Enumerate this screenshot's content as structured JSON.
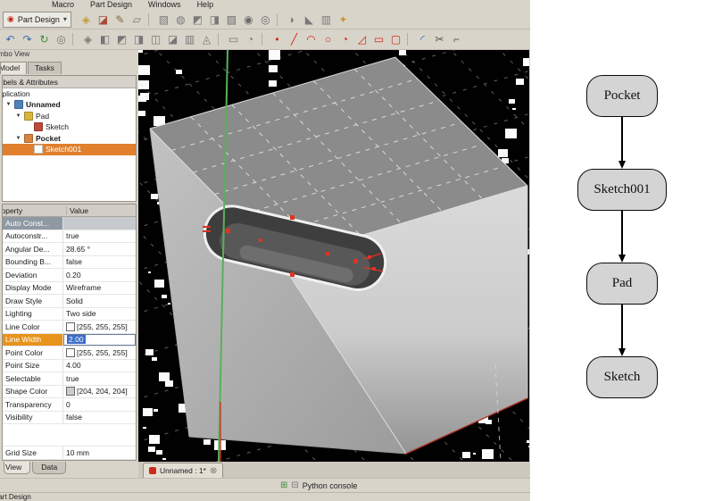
{
  "colors": {
    "selection_orange": "#e0802e",
    "edit_blue": "#3a6cc8",
    "viewport_green": "#58b158",
    "marker_red": "#e03322",
    "node_fill": "#d4d4d4",
    "line_color_value": "#ffffff",
    "shape_color_value": "#cccccc"
  },
  "menubar": {
    "items": [
      {
        "label": "Macro",
        "name": "menu-macro"
      },
      {
        "label": "Part Design",
        "name": "menu-part-design"
      },
      {
        "label": "Windows",
        "name": "menu-windows"
      },
      {
        "label": "Help",
        "name": "menu-help"
      }
    ]
  },
  "workbench_selector": {
    "label": "Part Design",
    "caret": "▾"
  },
  "toolbar_top": {
    "icons": [
      {
        "name": "create-body-icon",
        "glyph": "◈",
        "color": "#c49a3a"
      },
      {
        "name": "create-sketch-icon",
        "glyph": "◪",
        "color": "#a84a3a"
      },
      {
        "name": "edit-sketch-icon",
        "glyph": "✎",
        "color": "#7c6a3a"
      },
      {
        "name": "map-sketch-icon",
        "glyph": "▱",
        "color": "#787878"
      },
      {
        "sep": true
      },
      {
        "name": "pad-icon",
        "glyph": "▧",
        "color": "#7a7a7a"
      },
      {
        "name": "revolution-icon",
        "glyph": "◍",
        "color": "#7a7a7a"
      },
      {
        "name": "additive-loft-icon",
        "glyph": "◩",
        "color": "#7a7a7a"
      },
      {
        "name": "additive-pipe-icon",
        "glyph": "◨",
        "color": "#7a7a7a"
      },
      {
        "name": "pocket-icon",
        "glyph": "▨",
        "color": "#6a6a6a"
      },
      {
        "name": "hole-icon",
        "glyph": "◉",
        "color": "#6a6a6a"
      },
      {
        "name": "groove-icon",
        "glyph": "◎",
        "color": "#6a6a6a"
      },
      {
        "sep": true
      },
      {
        "name": "fillet-icon",
        "glyph": "◗",
        "color": "#7a7a7a"
      },
      {
        "name": "chamfer-icon",
        "glyph": "◣",
        "color": "#7a7a7a"
      },
      {
        "name": "linear-pattern-icon",
        "glyph": "▥",
        "color": "#7a7a7a"
      },
      {
        "name": "apply-pattern-icon",
        "glyph": "✦",
        "color": "#c49a3a"
      }
    ]
  },
  "toolbar_second": {
    "icons": [
      {
        "name": "undo-icon",
        "glyph": "↶",
        "color": "#3a6aa8"
      },
      {
        "name": "redo-icon",
        "glyph": "↷",
        "color": "#3a6aa8"
      },
      {
        "name": "refresh-icon",
        "glyph": "↻",
        "color": "#3a8a3a"
      },
      {
        "name": "fit-all-icon",
        "glyph": "◎",
        "color": "#777777"
      },
      {
        "sep": true
      },
      {
        "name": "isometric-view-icon",
        "glyph": "◈",
        "color": "#777777"
      },
      {
        "name": "front-view-icon",
        "glyph": "◧",
        "color": "#777777"
      },
      {
        "name": "top-view-icon",
        "glyph": "◩",
        "color": "#777777"
      },
      {
        "name": "right-view-icon",
        "glyph": "◨",
        "color": "#777777"
      },
      {
        "name": "rear-view-icon",
        "glyph": "◫",
        "color": "#777777"
      },
      {
        "name": "bottom-view-icon",
        "glyph": "◪",
        "color": "#777777"
      },
      {
        "name": "left-view-icon",
        "glyph": "▥",
        "color": "#777777"
      },
      {
        "name": "axonometric-icon",
        "glyph": "◬",
        "color": "#777777"
      },
      {
        "sep": true
      },
      {
        "name": "measure-icon",
        "glyph": "▭",
        "color": "#777777"
      },
      {
        "name": "clip-plane-icon",
        "glyph": "◔",
        "color": "#777777"
      },
      {
        "sep": true
      },
      {
        "name": "sketch-point-icon",
        "glyph": "•",
        "color": "#cc2a1a"
      },
      {
        "name": "sketch-line-icon",
        "glyph": "╱",
        "color": "#cc2a1a"
      },
      {
        "name": "sketch-arc-icon",
        "glyph": "◠",
        "color": "#cc2a1a"
      },
      {
        "name": "sketch-circle-icon",
        "glyph": "○",
        "color": "#cc2a1a"
      },
      {
        "name": "sketch-conic-icon",
        "glyph": "◔",
        "color": "#cc2a1a"
      },
      {
        "name": "sketch-polyline-icon",
        "glyph": "◿",
        "color": "#cc2a1a"
      },
      {
        "name": "sketch-rectangle-icon",
        "glyph": "▭",
        "color": "#cc2a1a"
      },
      {
        "name": "sketch-slot-icon",
        "glyph": "▢",
        "color": "#cc2a1a"
      },
      {
        "sep": true
      },
      {
        "name": "sketch-fillet-icon",
        "glyph": "◜",
        "color": "#2a62cc"
      },
      {
        "name": "sketch-trim-icon",
        "glyph": "✂",
        "color": "#555555"
      },
      {
        "name": "sketch-extend-icon",
        "glyph": "⌐",
        "color": "#555555"
      }
    ]
  },
  "combo_view": {
    "title": "Combo View",
    "tabs": [
      {
        "label": "Model",
        "active": true
      },
      {
        "label": "Tasks",
        "active": false
      }
    ],
    "tree": {
      "header": "Labels & Attributes",
      "root": "Application",
      "items": [
        {
          "label": "Unnamed",
          "name": "tree-item-unnamed",
          "level": 1,
          "iconColor": "#4f81bd",
          "bold": true,
          "expander": "▼"
        },
        {
          "label": "Pad",
          "name": "tree-item-pad",
          "level": 2,
          "iconColor": "#d8b83c",
          "expander": "▼"
        },
        {
          "label": "Sketch",
          "name": "tree-item-sketch",
          "level": 3,
          "iconColor": "#c04a3a"
        },
        {
          "label": "Pocket",
          "name": "tree-item-pocket",
          "level": 2,
          "iconColor": "#d8843c",
          "bold": true,
          "expander": "▼"
        },
        {
          "label": "Sketch001",
          "name": "tree-item-sketch001",
          "level": 3,
          "iconColor": "#ffffff",
          "selected": true
        }
      ]
    },
    "properties": {
      "header_name": "Property",
      "header_value": "Value",
      "rows": [
        {
          "name": "Auto Const...",
          "value": "",
          "row_name": "property-row-auto-constraints-group",
          "group": true
        },
        {
          "name": "Autoconstr...",
          "value": "true",
          "row_name": "property-row-autoconstraints"
        },
        {
          "name": "Angular De...",
          "value": "28.65 °",
          "row_name": "property-row-angular-deflection"
        },
        {
          "name": "Bounding B...",
          "value": "false",
          "row_name": "property-row-bounding-box"
        },
        {
          "name": "Deviation",
          "value": "0.20",
          "row_name": "property-row-deviation"
        },
        {
          "name": "Display Mode",
          "value": "Wireframe",
          "row_name": "property-row-display-mode"
        },
        {
          "name": "Draw Style",
          "value": "Solid",
          "row_name": "property-row-draw-style"
        },
        {
          "name": "Lighting",
          "value": "Two side",
          "row_name": "property-row-lighting"
        },
        {
          "name": "Line Color",
          "value": "[255, 255, 255]",
          "swatch": "#ffffff",
          "row_name": "property-row-line-color"
        },
        {
          "name": "Line Width",
          "value": "2.00",
          "editing": true,
          "row_name": "property-row-line-width"
        },
        {
          "name": "Point Color",
          "value": "[255, 255, 255]",
          "swatch": "#ffffff",
          "row_name": "property-row-point-color"
        },
        {
          "name": "Point Size",
          "value": "4.00",
          "row_name": "property-row-point-size"
        },
        {
          "name": "Selectable",
          "value": "true",
          "row_name": "property-row-selectable"
        },
        {
          "name": "Shape Color",
          "value": "[204, 204, 204]",
          "swatch": "#cccccc",
          "row_name": "property-row-shape-color"
        },
        {
          "name": "Transparency",
          "value": "0",
          "row_name": "property-row-transparency"
        },
        {
          "name": "Visibility",
          "value": "false",
          "row_name": "property-row-visibility"
        },
        {
          "name": "Grid Size",
          "value": "10 mm",
          "gap_before": true,
          "row_name": "property-row-grid-size"
        }
      ]
    },
    "bottom_tabs": [
      {
        "label": "View",
        "active": true
      },
      {
        "label": "Data",
        "active": false
      }
    ]
  },
  "viewport": {
    "document_tab": {
      "label": "Unnamed : 1*",
      "close_glyph": "⊗"
    },
    "console": {
      "label": "Python console"
    }
  },
  "statusbar": {
    "label": "Part Design"
  },
  "diagram": {
    "nodes": [
      {
        "label": "Pocket",
        "name": "graph-node-pocket"
      },
      {
        "label": "Sketch001",
        "name": "graph-node-sketch001"
      },
      {
        "label": "Pad",
        "name": "graph-node-pad"
      },
      {
        "label": "Sketch",
        "name": "graph-node-sketch"
      }
    ]
  }
}
